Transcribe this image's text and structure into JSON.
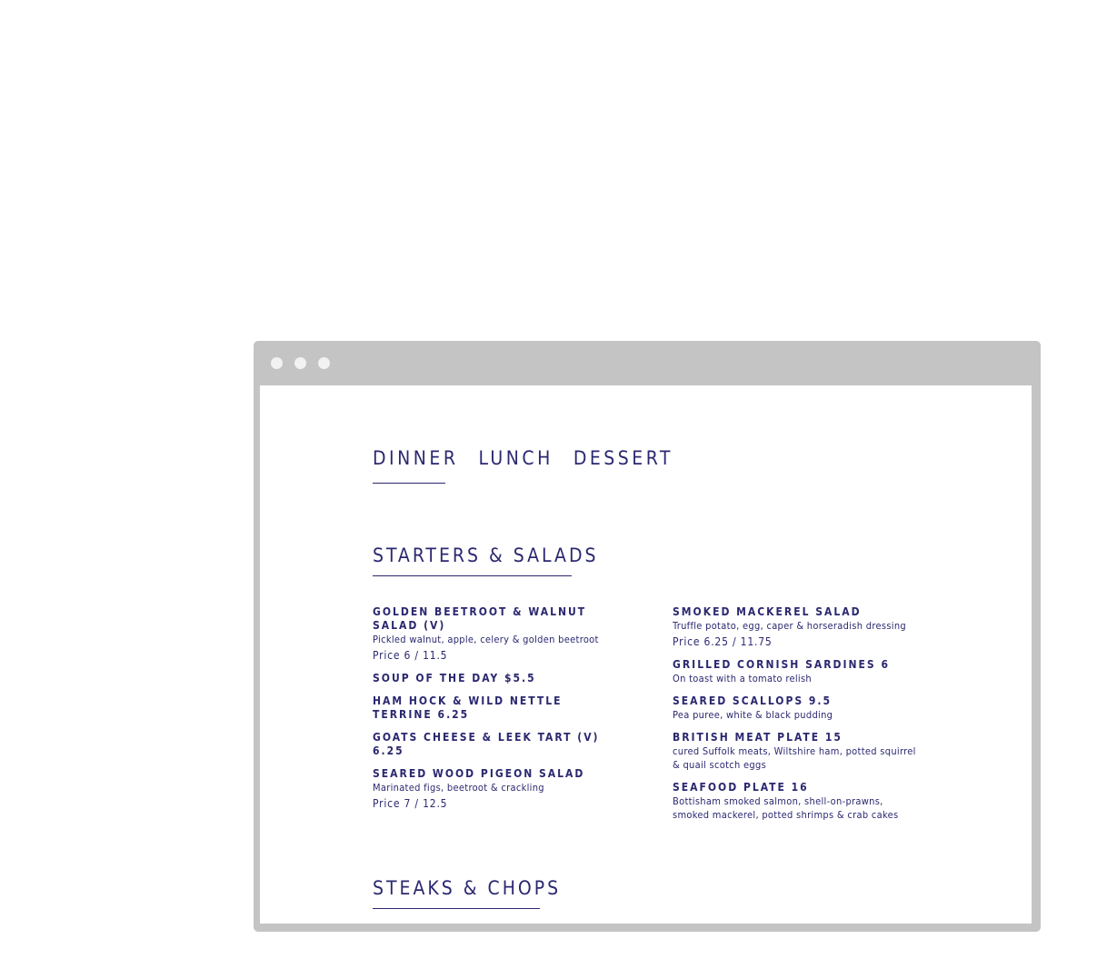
{
  "tabs": [
    "DINNER",
    "LUNCH",
    "DESSERT"
  ],
  "sections": {
    "starters_title": "STARTERS & SALADS",
    "steaks_title": "STEAKS & CHOPS"
  },
  "menu": {
    "left": [
      {
        "name": "GOLDEN BEETROOT & WALNUT SALAD (V)",
        "desc": "Pickled walnut, apple, celery & golden beetroot",
        "price": "Price 6 / 11.5"
      },
      {
        "name": "SOUP OF THE DAY $5.5"
      },
      {
        "name": "HAM HOCK & WILD NETTLE TERRINE 6.25"
      },
      {
        "name": "GOATS CHEESE & LEEK TART (V) 6.25"
      },
      {
        "name": "SEARED WOOD PIGEON SALAD",
        "desc": "Marinated figs, beetroot & crackling",
        "price": "Price 7 / 12.5"
      }
    ],
    "right": [
      {
        "name": "SMOKED MACKEREL SALAD",
        "desc": "Truffle potato, egg, caper & horseradish dressing",
        "price": "Price 6.25 / 11.75"
      },
      {
        "name": "GRILLED CORNISH SARDINES 6",
        "desc": "On toast with a tomato relish"
      },
      {
        "name": "SEARED SCALLOPS 9.5",
        "desc": "Pea puree, white & black pudding"
      },
      {
        "name": "BRITISH MEAT PLATE 15",
        "desc": "cured Suffolk meats, Wiltshire ham, potted squirrel & quail scotch eggs"
      },
      {
        "name": "SEAFOOD PLATE 16",
        "desc": "Bottisham smoked salmon, shell-on-prawns, smoked mackerel, potted shrimps & crab cakes"
      }
    ]
  }
}
